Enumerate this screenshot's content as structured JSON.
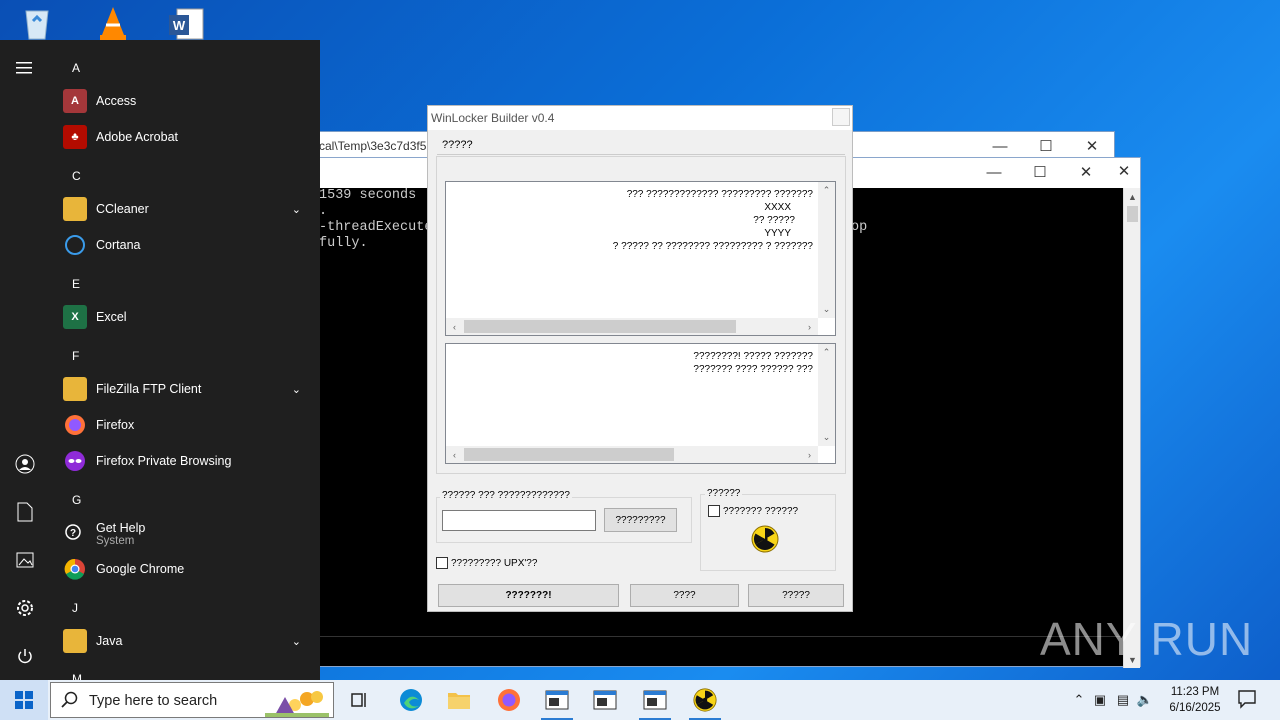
{
  "desktop": {
    "icons": [
      "recycle-bin-icon",
      "vlc-icon",
      "word-icon"
    ]
  },
  "console_back": {
    "path": "cal\\Temp\\3e3c7d3f5"
  },
  "console": {
    "lines": [
      "1539 seconds",
      ".",
      "-threadExecute",
      "fully."
    ],
    "line_op": "op"
  },
  "winlocker": {
    "title": "WinLocker Builder v0.4",
    "tab": "?????",
    "textbox1_lines": [
      "??? ????????????? ????????? ???????",
      "XXXX",
      "?? ?????",
      "YYYY",
      "? ????? ?? ???????? ????????? ? ???????"
    ],
    "textbox2_lines": [
      "????????! ????? ???????",
      "??????? ???? ?????? ???"
    ],
    "group_code_label": "?????? ??? ?????????????",
    "code_input_value": "",
    "generate_button": "?????????",
    "group_opts_label": "??????",
    "opt_checkbox_label": "??????? ??????",
    "upx_checkbox_label": "????????? UPX'??",
    "build_button": "???????!",
    "about_button": "????",
    "exit_button": "?????"
  },
  "start_menu": {
    "letters": [
      "A",
      "C",
      "E",
      "F",
      "G",
      "J",
      "M"
    ],
    "apps": [
      {
        "name": "Access",
        "sub": "",
        "expand": false
      },
      {
        "name": "Adobe Acrobat",
        "sub": "",
        "expand": false
      },
      {
        "name": "CCleaner",
        "sub": "",
        "expand": true
      },
      {
        "name": "Cortana",
        "sub": "",
        "expand": false
      },
      {
        "name": "Excel",
        "sub": "",
        "expand": false
      },
      {
        "name": "FileZilla FTP Client",
        "sub": "",
        "expand": true
      },
      {
        "name": "Firefox",
        "sub": "",
        "expand": false
      },
      {
        "name": "Firefox Private Browsing",
        "sub": "",
        "expand": false
      },
      {
        "name": "Get Help",
        "sub": "System",
        "expand": false
      },
      {
        "name": "Google Chrome",
        "sub": "",
        "expand": false
      },
      {
        "name": "Java",
        "sub": "",
        "expand": true
      }
    ]
  },
  "taskbar": {
    "search_placeholder": "Type here to search",
    "time": "11:23 PM",
    "date": "6/16/2025"
  },
  "watermark": "ANY RUN"
}
